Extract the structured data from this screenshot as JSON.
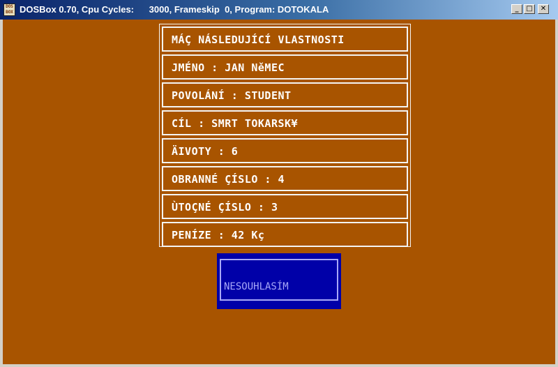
{
  "window": {
    "title": "DOSBox 0.70, Cpu Cycles:      3000, Frameskip  0, Program: DOTOKALA",
    "icon_text": "DOS BOX",
    "buttons": {
      "minimize": "_",
      "maximize": "□",
      "close": "✕"
    }
  },
  "colors": {
    "background": "#a85400",
    "text": "#ffffff",
    "button_bg": "#0000a8",
    "button_text": "#a8a8f8"
  },
  "stats": [
    "MÁÇ NÁSLEDUJÍCÍ VLASTNOSTI",
    "JMÉNO : JAN NěMEC",
    "POVOLÁNÍ : STUDENT",
    "CÍL : SMRT TOKARSK¥",
    "ÄIVOTY : 6",
    "OBRANNÉ ÇÍSLO : 4",
    "ÙTOÇNÉ ÇÍSLO : 3",
    "PENÍZE : 42 Kç"
  ],
  "button": {
    "label": "NESOUHLASÍM"
  }
}
